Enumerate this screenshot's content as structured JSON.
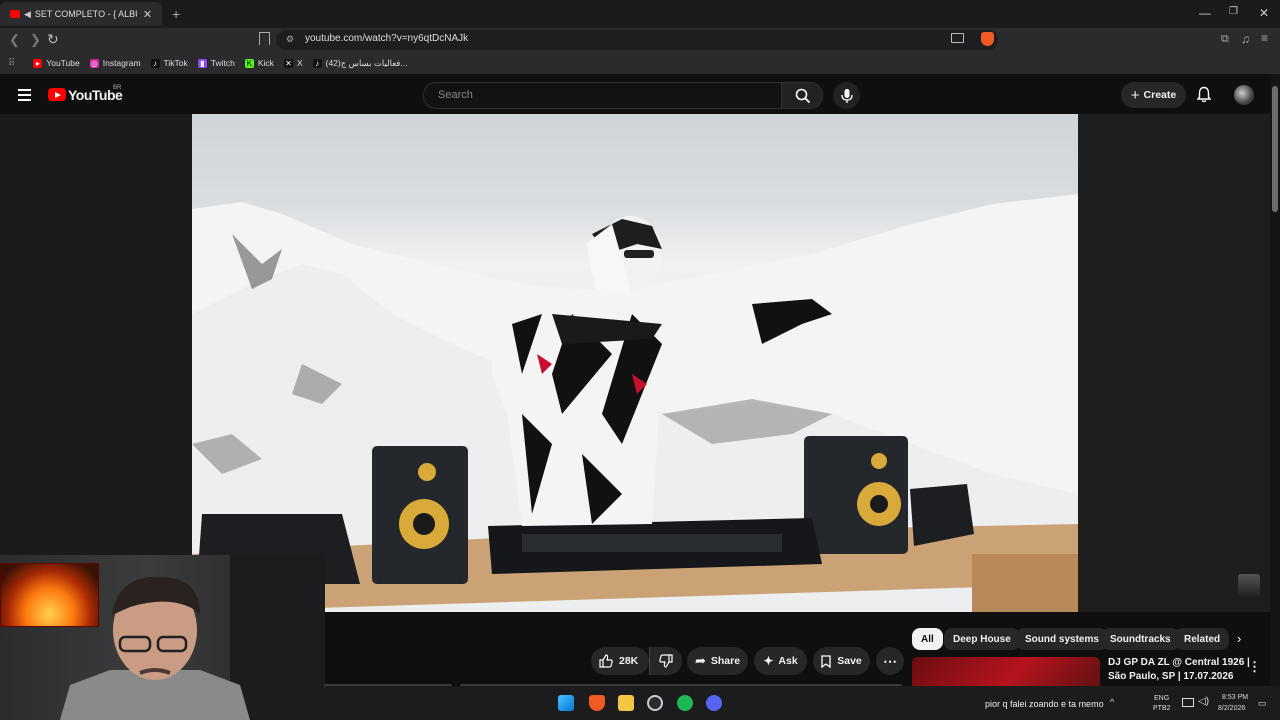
{
  "browser": {
    "tab_title": "SET COMPLETO - { ALBUM M",
    "new_tab": "+",
    "url": "youtube.com/watch?v=ny6qtDcNAJk"
  },
  "bookmarks": [
    {
      "label": "YouTube",
      "color": "#ff0000"
    },
    {
      "label": "Instagram",
      "color": "#d6249f"
    },
    {
      "label": "TikTok",
      "color": "#111111"
    },
    {
      "label": "Twitch",
      "color": "#9146ff"
    },
    {
      "label": "Kick",
      "color": "#53fc18"
    },
    {
      "label": "X",
      "color": "#111111"
    },
    {
      "label": "(42)فعاليات بساس ج...",
      "color": "#111111"
    }
  ],
  "youtube": {
    "logo_text": "YouTube",
    "country_code": "BR",
    "search_placeholder": "Search",
    "create_label": "Create"
  },
  "actions": {
    "like_count": "28K",
    "share_label": "Share",
    "ask_label": "Ask",
    "save_label": "Save"
  },
  "chips": [
    "All",
    "Deep House",
    "Sound systems",
    "Soundtracks",
    "Related"
  ],
  "recommendation": {
    "title_line1": "DJ GP DA ZL @ Central 1926 |",
    "title_line2": "São Paulo, SP | 17.07.2026"
  },
  "taskbar": {
    "notification": "pior q falei zoando e ta memo",
    "lang_line1": "ENG",
    "lang_line2": "PTB2",
    "time": "8:53 PM",
    "date": "8/2/2026"
  }
}
